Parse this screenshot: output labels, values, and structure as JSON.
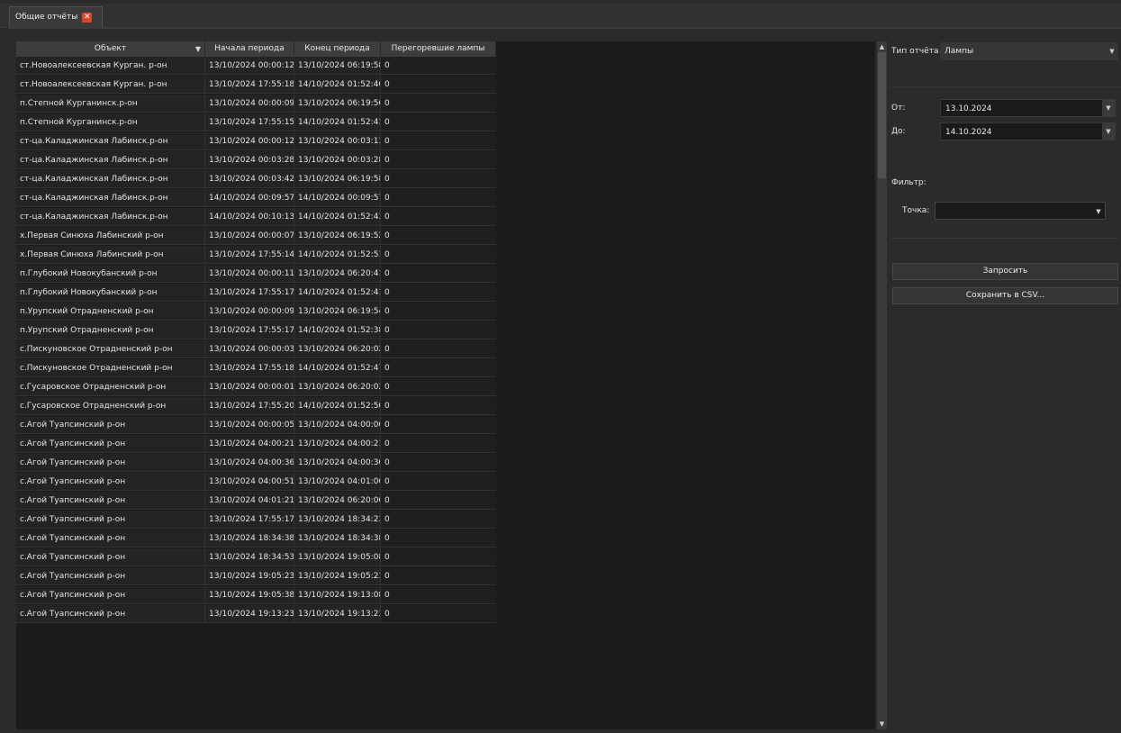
{
  "tab": {
    "title": "Общие отчёты",
    "close_glyph": "✕"
  },
  "table": {
    "columns": [
      "Объект",
      "Начала периода",
      "Конец периода",
      "Перегоревшие лампы"
    ],
    "sort_glyph": "▼",
    "rows": [
      [
        "ст.Новоалексеевская Курган. р-он",
        "13/10/2024 00:00:12",
        "13/10/2024 06:19:58",
        "0"
      ],
      [
        "ст.Новоалексеевская Курган. р-он",
        "13/10/2024 17:55:18",
        "14/10/2024 01:52:46",
        "0"
      ],
      [
        "п.Степной Курганинск.р-он",
        "13/10/2024 00:00:09",
        "13/10/2024 06:19:56",
        "0"
      ],
      [
        "п.Степной Курганинск.р-он",
        "13/10/2024 17:55:15",
        "14/10/2024 01:52:43",
        "0"
      ],
      [
        "ст-ца.Каладжинская Лабинск.р-он",
        "13/10/2024 00:00:12",
        "13/10/2024 00:03:13",
        "0"
      ],
      [
        "ст-ца.Каладжинская Лабинск.р-он",
        "13/10/2024 00:03:28",
        "13/10/2024 00:03:28",
        "0"
      ],
      [
        "ст-ца.Каладжинская Лабинск.р-он",
        "13/10/2024 00:03:42",
        "13/10/2024 06:19:58",
        "0"
      ],
      [
        "ст-ца.Каладжинская Лабинск.р-он",
        "14/10/2024 00:09:57",
        "14/10/2024 00:09:57",
        "0"
      ],
      [
        "ст-ца.Каладжинская Лабинск.р-он",
        "14/10/2024 00:10:13",
        "14/10/2024 01:52:43",
        "0"
      ],
      [
        "х.Первая Синюха Лабинский р-он",
        "13/10/2024 00:00:07",
        "13/10/2024 06:19:52",
        "0"
      ],
      [
        "х.Первая Синюха Лабинский р-он",
        "13/10/2024 17:55:14",
        "14/10/2024 01:52:51",
        "0"
      ],
      [
        "п.Глубокий Новокубанский р-он",
        "13/10/2024 00:00:11",
        "13/10/2024 06:20:41",
        "0"
      ],
      [
        "п.Глубокий Новокубанский р-он",
        "13/10/2024 17:55:17",
        "14/10/2024 01:52:41",
        "0"
      ],
      [
        "п.Урупский Отрадненский р-он",
        "13/10/2024 00:00:09",
        "13/10/2024 06:19:54",
        "0"
      ],
      [
        "п.Урупский Отрадненский р-он",
        "13/10/2024 17:55:17",
        "14/10/2024 01:52:38",
        "0"
      ],
      [
        "с.Пискуновское Отрадненский р-он",
        "13/10/2024 00:00:03",
        "13/10/2024 06:20:02",
        "0"
      ],
      [
        "с.Пискуновское Отрадненский р-он",
        "13/10/2024 17:55:18",
        "14/10/2024 01:52:47",
        "0"
      ],
      [
        "с.Гусаровское Отрадненский р-он",
        "13/10/2024 00:00:01",
        "13/10/2024 06:20:02",
        "0"
      ],
      [
        "с.Гусаровское Отрадненский р-он",
        "13/10/2024 17:55:20",
        "14/10/2024 01:52:50",
        "0"
      ],
      [
        "с.Агой Туапсинский р-он",
        "13/10/2024 00:00:05",
        "13/10/2024 04:00:06",
        "0"
      ],
      [
        "с.Агой Туапсинский р-он",
        "13/10/2024 04:00:21",
        "13/10/2024 04:00:21",
        "0"
      ],
      [
        "с.Агой Туапсинский р-он",
        "13/10/2024 04:00:36",
        "13/10/2024 04:00:36",
        "0"
      ],
      [
        "с.Агой Туапсинский р-он",
        "13/10/2024 04:00:51",
        "13/10/2024 04:01:06",
        "0"
      ],
      [
        "с.Агой Туапсинский р-он",
        "13/10/2024 04:01:21",
        "13/10/2024 06:20:06",
        "0"
      ],
      [
        "с.Агой Туапсинский р-он",
        "13/10/2024 17:55:17",
        "13/10/2024 18:34:23",
        "0"
      ],
      [
        "с.Агой Туапсинский р-он",
        "13/10/2024 18:34:38",
        "13/10/2024 18:34:38",
        "0"
      ],
      [
        "с.Агой Туапсинский р-он",
        "13/10/2024 18:34:53",
        "13/10/2024 19:05:08",
        "0"
      ],
      [
        "с.Агой Туапсинский р-он",
        "13/10/2024 19:05:23",
        "13/10/2024 19:05:23",
        "0"
      ],
      [
        "с.Агой Туапсинский р-он",
        "13/10/2024 19:05:38",
        "13/10/2024 19:13:08",
        "0"
      ],
      [
        "с.Агой Туапсинский р-он",
        "13/10/2024 19:13:23",
        "13/10/2024 19:13:23",
        "0"
      ]
    ]
  },
  "scrollbar": {
    "up_glyph": "▲",
    "down_glyph": "▼"
  },
  "panel": {
    "report_type_label": "Тип отчёта",
    "report_type_value": "Лампы",
    "from_label": "От:",
    "from_value": "13.10.2024",
    "to_label": "До:",
    "to_value": "14.10.2024",
    "filter_label": "Фильтр:",
    "point_label": "Точка:",
    "point_value": "",
    "dropdown_glyph": "▼",
    "request_button": "Запросить",
    "csv_button": "Сохранить в CSV..."
  }
}
